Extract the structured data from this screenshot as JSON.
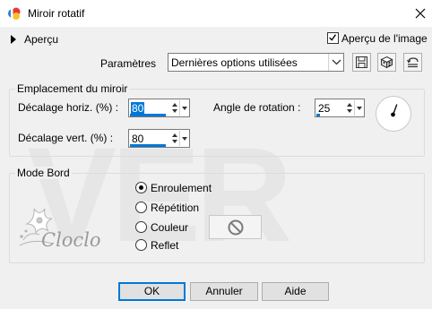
{
  "window": {
    "title": "Miroir rotatif",
    "watermark": "VER",
    "logo_text": "Cloclo"
  },
  "preview": {
    "label": "Aperçu",
    "image_preview_label": "Aperçu de l'image",
    "image_preview_checked": true
  },
  "presets": {
    "label": "Paramètres",
    "selected": "Dernières options utilisées"
  },
  "mirror": {
    "title": "Emplacement du miroir",
    "h_offset_label": "Décalage horiz. (%) :",
    "h_offset_value": "80",
    "v_offset_label": "Décalage vert. (%) :",
    "v_offset_value": "80",
    "angle_label": "Angle de rotation :",
    "angle_value": "25"
  },
  "edge": {
    "title": "Mode Bord",
    "options": [
      {
        "label": "Enroulement",
        "selected": true
      },
      {
        "label": "Répétition",
        "selected": false
      },
      {
        "label": "Couleur",
        "selected": false
      },
      {
        "label": "Reflet",
        "selected": false
      }
    ]
  },
  "buttons": {
    "ok": "OK",
    "cancel": "Annuler",
    "help": "Aide"
  },
  "icons": [
    "app-icon",
    "close-icon",
    "save-preset-icon",
    "randomize-icon",
    "reset-icon",
    "angle-dial-icon",
    "no-color-icon"
  ]
}
